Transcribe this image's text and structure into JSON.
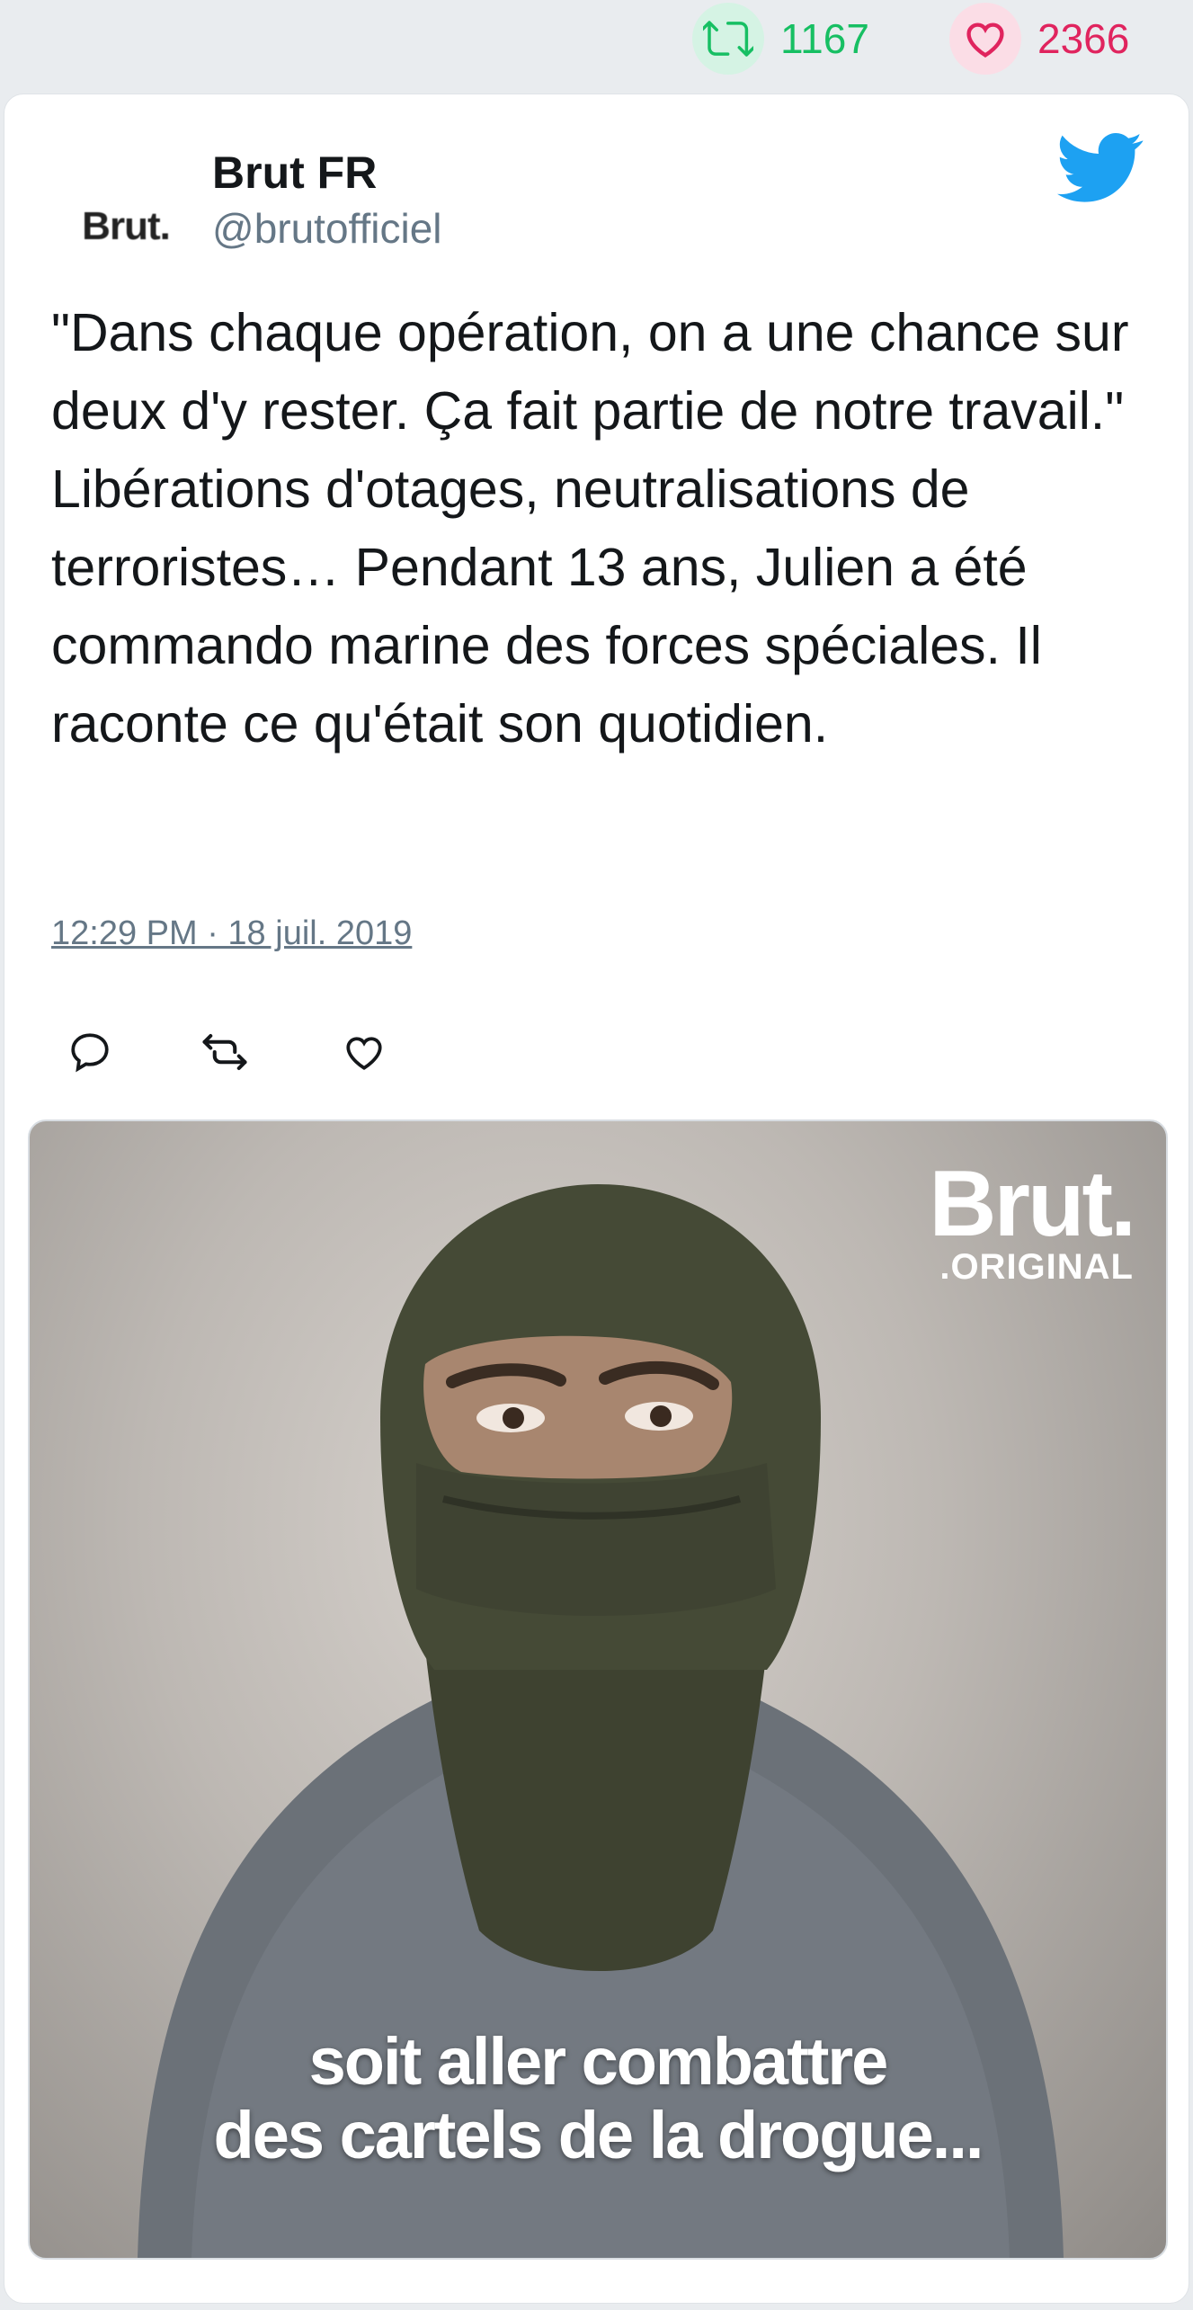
{
  "stats": {
    "retweets": "1167",
    "likes": "2366",
    "retweet_color": "#17bf63",
    "like_color": "#e0245e",
    "retweet_icon": "retweet-icon",
    "like_icon": "heart-icon"
  },
  "author": {
    "avatar_text": "Brut.",
    "name": "Brut FR",
    "handle": "@brutofficiel"
  },
  "platform_icon": "twitter-bird-icon",
  "tweet": {
    "text": "\"Dans chaque opération, on a une chance sur deux d'y rester. Ça fait partie de notre travail.\" Libérations d'otages, neutralisations de terroristes… Pendant 13 ans, Julien a été commando marine des forces spéciales. Il raconte ce qu'était son quotidien.",
    "timestamp": "12:29 PM · 18 juil. 2019"
  },
  "actions": [
    "reply-icon",
    "retweet-icon",
    "heart-icon"
  ],
  "media": {
    "logo_big": "Brut.",
    "logo_small": ".ORIGINAL",
    "subtitle_line1": "soit aller combattre",
    "subtitle_line2": "des cartels de la drogue..."
  }
}
